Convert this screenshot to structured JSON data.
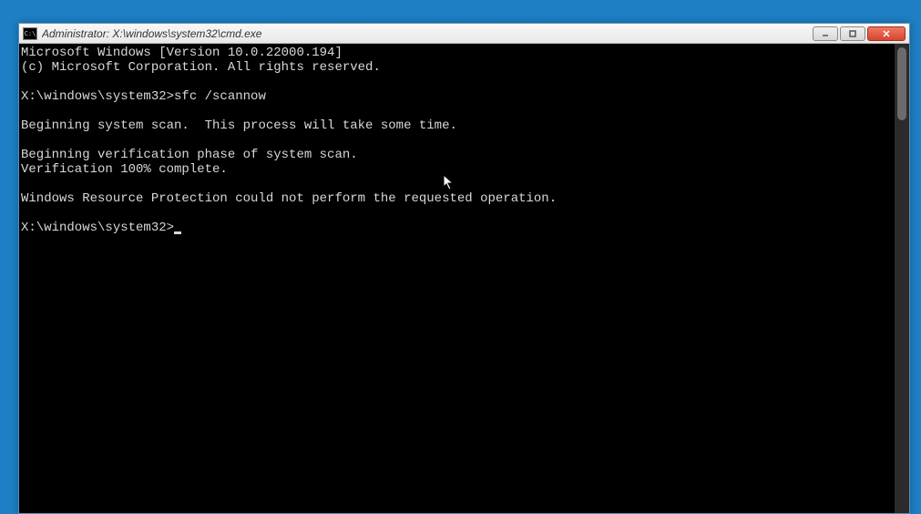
{
  "window": {
    "title": "Administrator: X:\\windows\\system32\\cmd.exe",
    "icon_label": "C:\\"
  },
  "terminal": {
    "lines": [
      "Microsoft Windows [Version 10.0.22000.194]",
      "(c) Microsoft Corporation. All rights reserved.",
      "",
      "X:\\windows\\system32>sfc /scannow",
      "",
      "Beginning system scan.  This process will take some time.",
      "",
      "Beginning verification phase of system scan.",
      "Verification 100% complete.",
      "",
      "Windows Resource Protection could not perform the requested operation.",
      "",
      "X:\\windows\\system32>"
    ]
  }
}
